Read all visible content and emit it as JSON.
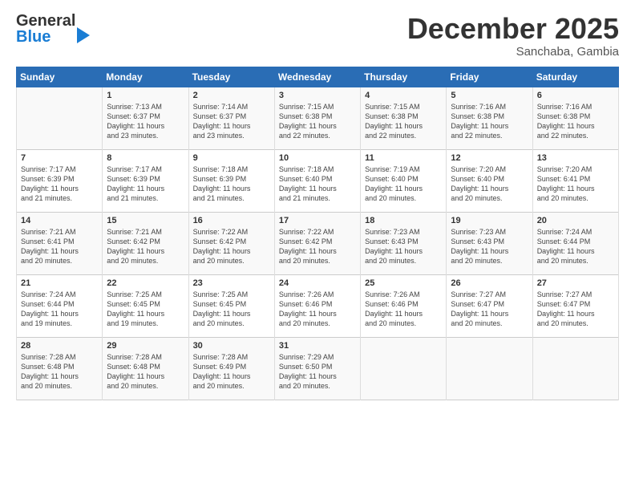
{
  "logo": {
    "line1": "General",
    "line2": "Blue"
  },
  "title": "December 2025",
  "subtitle": "Sanchaba, Gambia",
  "days_header": [
    "Sunday",
    "Monday",
    "Tuesday",
    "Wednesday",
    "Thursday",
    "Friday",
    "Saturday"
  ],
  "weeks": [
    [
      {
        "num": "",
        "sunrise": "",
        "sunset": "",
        "daylight": ""
      },
      {
        "num": "1",
        "sunrise": "Sunrise: 7:13 AM",
        "sunset": "Sunset: 6:37 PM",
        "daylight": "Daylight: 11 hours and 23 minutes."
      },
      {
        "num": "2",
        "sunrise": "Sunrise: 7:14 AM",
        "sunset": "Sunset: 6:37 PM",
        "daylight": "Daylight: 11 hours and 23 minutes."
      },
      {
        "num": "3",
        "sunrise": "Sunrise: 7:15 AM",
        "sunset": "Sunset: 6:38 PM",
        "daylight": "Daylight: 11 hours and 22 minutes."
      },
      {
        "num": "4",
        "sunrise": "Sunrise: 7:15 AM",
        "sunset": "Sunset: 6:38 PM",
        "daylight": "Daylight: 11 hours and 22 minutes."
      },
      {
        "num": "5",
        "sunrise": "Sunrise: 7:16 AM",
        "sunset": "Sunset: 6:38 PM",
        "daylight": "Daylight: 11 hours and 22 minutes."
      },
      {
        "num": "6",
        "sunrise": "Sunrise: 7:16 AM",
        "sunset": "Sunset: 6:38 PM",
        "daylight": "Daylight: 11 hours and 22 minutes."
      }
    ],
    [
      {
        "num": "7",
        "sunrise": "Sunrise: 7:17 AM",
        "sunset": "Sunset: 6:39 PM",
        "daylight": "Daylight: 11 hours and 21 minutes."
      },
      {
        "num": "8",
        "sunrise": "Sunrise: 7:17 AM",
        "sunset": "Sunset: 6:39 PM",
        "daylight": "Daylight: 11 hours and 21 minutes."
      },
      {
        "num": "9",
        "sunrise": "Sunrise: 7:18 AM",
        "sunset": "Sunset: 6:39 PM",
        "daylight": "Daylight: 11 hours and 21 minutes."
      },
      {
        "num": "10",
        "sunrise": "Sunrise: 7:18 AM",
        "sunset": "Sunset: 6:40 PM",
        "daylight": "Daylight: 11 hours and 21 minutes."
      },
      {
        "num": "11",
        "sunrise": "Sunrise: 7:19 AM",
        "sunset": "Sunset: 6:40 PM",
        "daylight": "Daylight: 11 hours and 20 minutes."
      },
      {
        "num": "12",
        "sunrise": "Sunrise: 7:20 AM",
        "sunset": "Sunset: 6:40 PM",
        "daylight": "Daylight: 11 hours and 20 minutes."
      },
      {
        "num": "13",
        "sunrise": "Sunrise: 7:20 AM",
        "sunset": "Sunset: 6:41 PM",
        "daylight": "Daylight: 11 hours and 20 minutes."
      }
    ],
    [
      {
        "num": "14",
        "sunrise": "Sunrise: 7:21 AM",
        "sunset": "Sunset: 6:41 PM",
        "daylight": "Daylight: 11 hours and 20 minutes."
      },
      {
        "num": "15",
        "sunrise": "Sunrise: 7:21 AM",
        "sunset": "Sunset: 6:42 PM",
        "daylight": "Daylight: 11 hours and 20 minutes."
      },
      {
        "num": "16",
        "sunrise": "Sunrise: 7:22 AM",
        "sunset": "Sunset: 6:42 PM",
        "daylight": "Daylight: 11 hours and 20 minutes."
      },
      {
        "num": "17",
        "sunrise": "Sunrise: 7:22 AM",
        "sunset": "Sunset: 6:42 PM",
        "daylight": "Daylight: 11 hours and 20 minutes."
      },
      {
        "num": "18",
        "sunrise": "Sunrise: 7:23 AM",
        "sunset": "Sunset: 6:43 PM",
        "daylight": "Daylight: 11 hours and 20 minutes."
      },
      {
        "num": "19",
        "sunrise": "Sunrise: 7:23 AM",
        "sunset": "Sunset: 6:43 PM",
        "daylight": "Daylight: 11 hours and 20 minutes."
      },
      {
        "num": "20",
        "sunrise": "Sunrise: 7:24 AM",
        "sunset": "Sunset: 6:44 PM",
        "daylight": "Daylight: 11 hours and 20 minutes."
      }
    ],
    [
      {
        "num": "21",
        "sunrise": "Sunrise: 7:24 AM",
        "sunset": "Sunset: 6:44 PM",
        "daylight": "Daylight: 11 hours and 19 minutes."
      },
      {
        "num": "22",
        "sunrise": "Sunrise: 7:25 AM",
        "sunset": "Sunset: 6:45 PM",
        "daylight": "Daylight: 11 hours and 19 minutes."
      },
      {
        "num": "23",
        "sunrise": "Sunrise: 7:25 AM",
        "sunset": "Sunset: 6:45 PM",
        "daylight": "Daylight: 11 hours and 20 minutes."
      },
      {
        "num": "24",
        "sunrise": "Sunrise: 7:26 AM",
        "sunset": "Sunset: 6:46 PM",
        "daylight": "Daylight: 11 hours and 20 minutes."
      },
      {
        "num": "25",
        "sunrise": "Sunrise: 7:26 AM",
        "sunset": "Sunset: 6:46 PM",
        "daylight": "Daylight: 11 hours and 20 minutes."
      },
      {
        "num": "26",
        "sunrise": "Sunrise: 7:27 AM",
        "sunset": "Sunset: 6:47 PM",
        "daylight": "Daylight: 11 hours and 20 minutes."
      },
      {
        "num": "27",
        "sunrise": "Sunrise: 7:27 AM",
        "sunset": "Sunset: 6:47 PM",
        "daylight": "Daylight: 11 hours and 20 minutes."
      }
    ],
    [
      {
        "num": "28",
        "sunrise": "Sunrise: 7:28 AM",
        "sunset": "Sunset: 6:48 PM",
        "daylight": "Daylight: 11 hours and 20 minutes."
      },
      {
        "num": "29",
        "sunrise": "Sunrise: 7:28 AM",
        "sunset": "Sunset: 6:48 PM",
        "daylight": "Daylight: 11 hours and 20 minutes."
      },
      {
        "num": "30",
        "sunrise": "Sunrise: 7:28 AM",
        "sunset": "Sunset: 6:49 PM",
        "daylight": "Daylight: 11 hours and 20 minutes."
      },
      {
        "num": "31",
        "sunrise": "Sunrise: 7:29 AM",
        "sunset": "Sunset: 6:50 PM",
        "daylight": "Daylight: 11 hours and 20 minutes."
      },
      {
        "num": "",
        "sunrise": "",
        "sunset": "",
        "daylight": ""
      },
      {
        "num": "",
        "sunrise": "",
        "sunset": "",
        "daylight": ""
      },
      {
        "num": "",
        "sunrise": "",
        "sunset": "",
        "daylight": ""
      }
    ]
  ]
}
